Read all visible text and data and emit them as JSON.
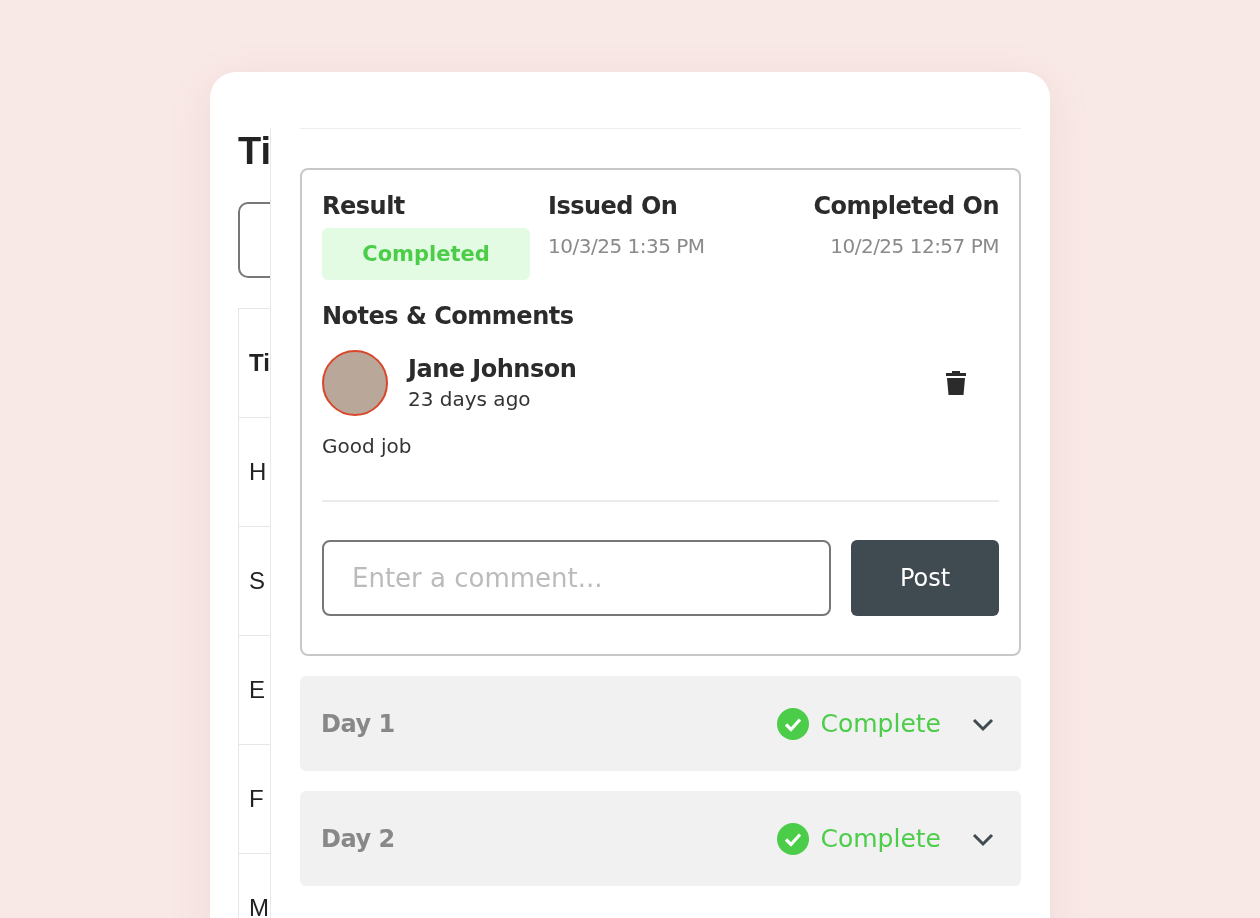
{
  "background_page": {
    "heading": "Ti",
    "table": {
      "header": "Ti",
      "rows": [
        "H",
        "S",
        "E",
        "F",
        "M"
      ]
    }
  },
  "result_panel": {
    "fields": [
      {
        "kind": "badge",
        "label": "Result",
        "value": "Completed"
      },
      {
        "kind": "date",
        "label": "Issued On",
        "value": "10/3/25 1:35 PM"
      },
      {
        "kind": "date",
        "label": "Completed On",
        "value": "10/2/25 12:57 PM"
      }
    ],
    "notes_title": "Notes & Comments",
    "comments": [
      {
        "author": "Jane Johnson",
        "time": "23 days ago",
        "text": "Good job"
      }
    ],
    "comment_input": {
      "placeholder": "Enter a comment..."
    },
    "post_button": "Post"
  },
  "days": [
    {
      "label": "Day 1",
      "status": "Complete",
      "expanded": false
    },
    {
      "label": "Day 2",
      "status": "Complete",
      "expanded": false
    }
  ]
}
